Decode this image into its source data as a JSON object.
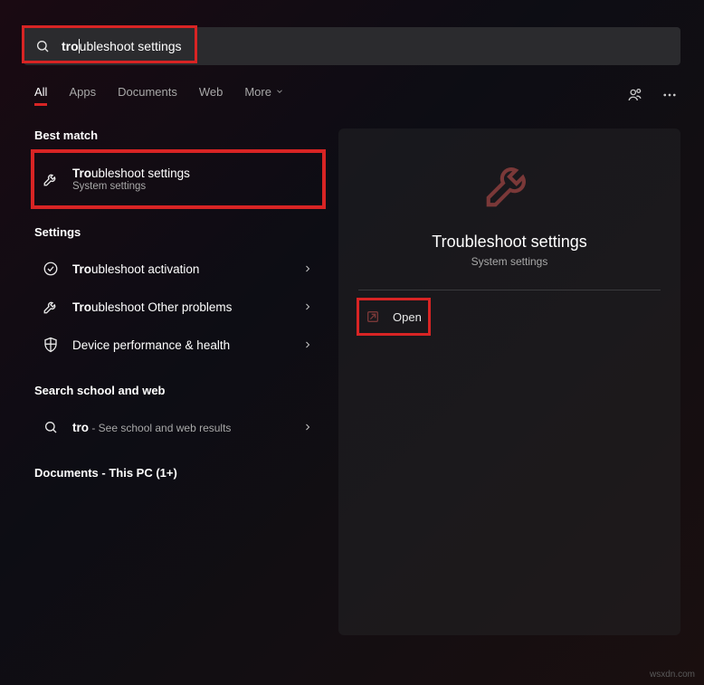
{
  "search": {
    "typed_prefix": "tro",
    "completion": "ubleshoot settings"
  },
  "tabs": {
    "all": "All",
    "apps": "Apps",
    "documents": "Documents",
    "web": "Web",
    "more": "More"
  },
  "sections": {
    "best_match": "Best match",
    "settings": "Settings",
    "search_web": "Search school and web",
    "documents_pc": "Documents - This PC (1+)"
  },
  "best_match": {
    "title_hl": "Tro",
    "title_rest": "ubleshoot settings",
    "sub": "System settings"
  },
  "settings_items": [
    {
      "title_hl": "Tro",
      "title_rest": "ubleshoot activation",
      "icon": "check"
    },
    {
      "title_hl": "Tro",
      "title_rest": "ubleshoot Other problems",
      "icon": "wrench"
    },
    {
      "title_hl": "",
      "title_rest": "Device performance & health",
      "icon": "shield"
    }
  ],
  "web_item": {
    "query_hl": "tro",
    "suffix": " - See school and web results"
  },
  "preview": {
    "title": "Troubleshoot settings",
    "sub": "System settings",
    "open": "Open"
  },
  "watermark": "wsxdn.com"
}
